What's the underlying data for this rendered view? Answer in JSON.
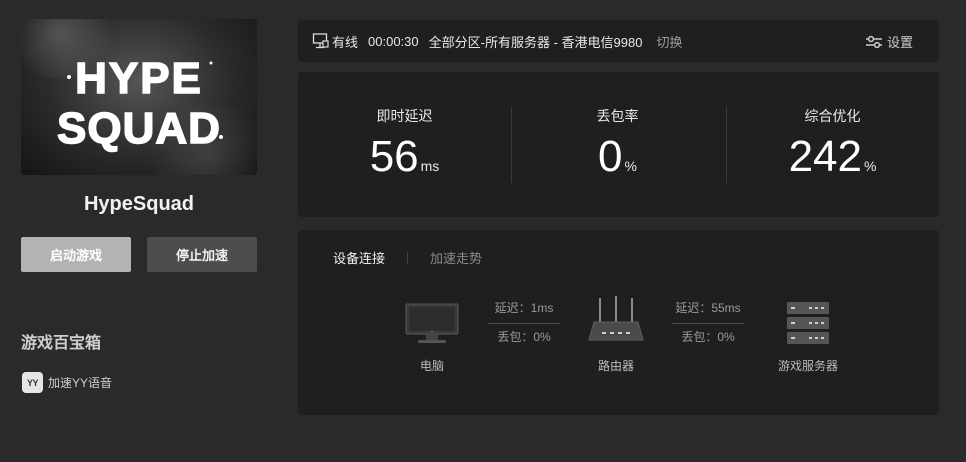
{
  "game": {
    "cover_text_line1": "HYPE",
    "cover_text_line2": "SQUAD",
    "title": "HypeSquad",
    "start_label": "启动游戏",
    "stop_label": "停止加速"
  },
  "toolbox": {
    "title": "游戏百宝箱",
    "items": [
      {
        "icon": "yy-icon",
        "icon_text": "YY",
        "label": "加速YY语音"
      }
    ]
  },
  "status": {
    "icon": "network-icon",
    "online": "有线",
    "timer": "00:00:30",
    "region": "全部分区-所有服务器 -  香港电信9980",
    "switch_label": "切换",
    "settings_label": "设置"
  },
  "stats": [
    {
      "label": "即时延迟",
      "value": "56",
      "unit": "ms"
    },
    {
      "label": "丢包率",
      "value": "0",
      "unit": "%"
    },
    {
      "label": "综合优化",
      "value": "242",
      "unit": "%"
    }
  ],
  "connection": {
    "tab_active": "设备连接",
    "tab_other": "加速走势",
    "nodes": {
      "pc": "电脑",
      "router": "路由器",
      "server": "游戏服务器"
    },
    "link1": {
      "latency": "延迟：1ms",
      "loss": "丢包：0%"
    },
    "link2": {
      "latency": "延迟：55ms",
      "loss": "丢包：0%"
    }
  },
  "colors": {
    "background": "#2a2a2a",
    "panel": "#1f1f1f",
    "start_button": "#b3b3b3",
    "stop_button": "#4d4d4d"
  }
}
